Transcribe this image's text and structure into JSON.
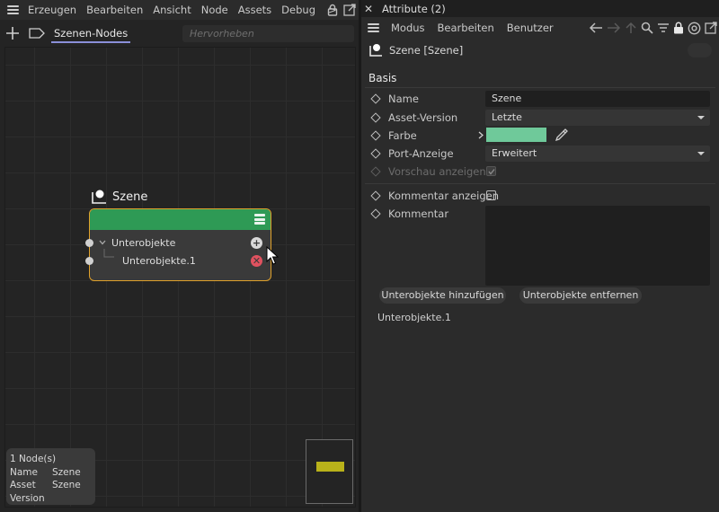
{
  "node_editor": {
    "menu": [
      "Erzeugen",
      "Bearbeiten",
      "Ansicht",
      "Node",
      "Assets",
      "Debug"
    ],
    "more_label": ">",
    "tab_label": "Szenen-Nodes",
    "highlight_placeholder": "Hervorheben",
    "node": {
      "title": "Szene",
      "header_color": "#2e9a55",
      "border_color": "#e0a12b",
      "ports": [
        {
          "label": "Unterobjekte",
          "action": "plus"
        },
        {
          "label": "Unterobjekte.1",
          "action": "remove"
        }
      ]
    },
    "info": {
      "count": "1 Node(s)",
      "rows": [
        {
          "key": "Name",
          "value": "Szene"
        },
        {
          "key": "Asset",
          "value": "Szene"
        },
        {
          "key": "Version",
          "value": ""
        }
      ]
    },
    "minimap_node_color": "#b9b21a"
  },
  "attributes": {
    "window_title": "Attribute (2)",
    "close_label": "✕",
    "menu": [
      "Modus",
      "Bearbeiten",
      "Benutzer"
    ],
    "object_name": "Szene [Szene]",
    "section": "Basis",
    "props": {
      "name": {
        "label": "Name",
        "value": "Szene"
      },
      "asset_version": {
        "label": "Asset-Version",
        "value": "Letzte"
      },
      "color": {
        "label": "Farbe",
        "swatch": "#6fc99a"
      },
      "port_display": {
        "label": "Port-Anzeige",
        "value": "Erweitert"
      },
      "preview": {
        "label": "Vorschau anzeigen",
        "checked": true
      },
      "show_comment": {
        "label": "Kommentar anzeigen",
        "checked": false
      },
      "comment": {
        "label": "Kommentar",
        "value": ""
      }
    },
    "buttons": {
      "add": "Unterobjekte hinzufügen",
      "remove": "Unterobjekte entfernen"
    },
    "subobject_text": "Unterobjekte.1"
  }
}
